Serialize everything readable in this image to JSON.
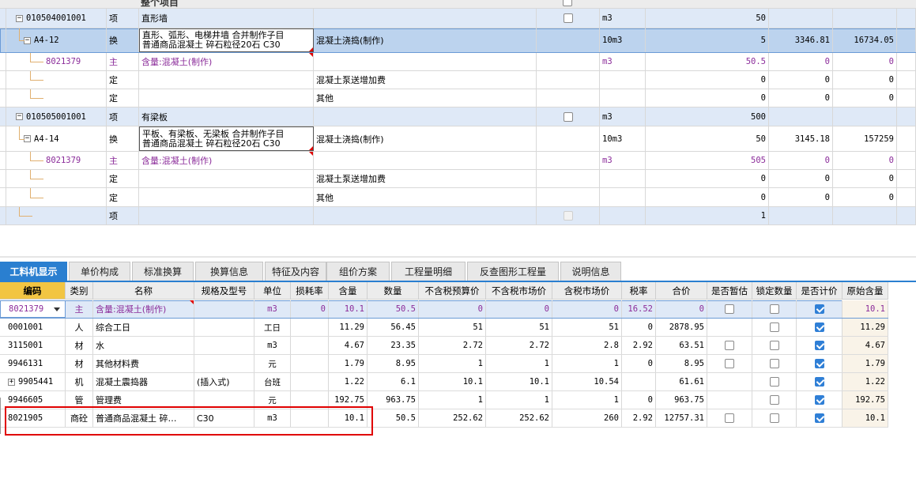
{
  "top_header": {
    "title": "整个项目"
  },
  "top_rows": [
    {
      "code": "010504001001",
      "type": "项",
      "name": "直形墙",
      "unit": "m3",
      "qty": "50"
    },
    {
      "code": "A4-12",
      "type": "换",
      "name_line1": "直形、弧形、电梯井墙  合并制作子目",
      "name_line2": "普通商品混凝土 碎石粒径20石 C30",
      "spec": "混凝土浇捣(制作)",
      "unit": "10m3",
      "qty": "5",
      "price": "3346.81",
      "total": "16734.05"
    },
    {
      "code": "8021379",
      "type": "主",
      "name": "含量:混凝土(制作)",
      "unit": "m3",
      "qty": "50.5",
      "price": "0",
      "total": "0"
    },
    {
      "type": "定",
      "spec": "混凝土泵送增加费",
      "qty": "0",
      "price": "0",
      "total": "0"
    },
    {
      "type": "定",
      "spec": "其他",
      "qty": "0",
      "price": "0",
      "total": "0"
    },
    {
      "code": "010505001001",
      "type": "项",
      "name": "有梁板",
      "unit": "m3",
      "qty": "500"
    },
    {
      "code": "A4-14",
      "type": "换",
      "name_line1": "平板、有梁板、无梁板  合并制作子目",
      "name_line2": "普通商品混凝土 碎石粒径20石 C30",
      "spec": "混凝土浇捣(制作)",
      "unit": "10m3",
      "qty": "50",
      "price": "3145.18",
      "total": "157259"
    },
    {
      "code": "8021379",
      "type": "主",
      "name": "含量:混凝土(制作)",
      "unit": "m3",
      "qty": "505",
      "price": "0",
      "total": "0"
    },
    {
      "type": "定",
      "spec": "混凝土泵送增加费",
      "qty": "0",
      "price": "0",
      "total": "0"
    },
    {
      "type": "定",
      "spec": "其他",
      "qty": "0",
      "price": "0",
      "total": "0"
    },
    {
      "type": "项",
      "qty": "1"
    }
  ],
  "tabs": [
    "工料机显示",
    "单价构成",
    "标准换算",
    "换算信息",
    "特征及内容",
    "组价方案",
    "工程量明细",
    "反查图形工程量",
    "说明信息"
  ],
  "columns": [
    "编码",
    "类别",
    "名称",
    "规格及型号",
    "单位",
    "损耗率",
    "含量",
    "数量",
    "不含税预算价",
    "不含税市场价",
    "含税市场价",
    "税率",
    "合价",
    "是否暂估",
    "锁定数量",
    "是否计价",
    "原始含量"
  ],
  "rows": [
    {
      "code": "8021379",
      "cat": "主",
      "name": "含量:混凝土(制作)",
      "spec": "",
      "unit": "m3",
      "loss": "0",
      "content": "10.1",
      "qty": "50.5",
      "p1": "0",
      "p2": "0",
      "p3": "0",
      "tax": "16.52",
      "total": "0",
      "est": false,
      "lock": false,
      "price_on": true,
      "orig": "10.1"
    },
    {
      "code": "0001001",
      "cat": "人",
      "name": "综合工日",
      "spec": "",
      "unit": "工日",
      "loss": "",
      "content": "11.29",
      "qty": "56.45",
      "p1": "51",
      "p2": "51",
      "p3": "51",
      "tax": "0",
      "total": "2878.95",
      "est": null,
      "lock": false,
      "price_on": true,
      "orig": "11.29"
    },
    {
      "code": "3115001",
      "cat": "材",
      "name": "水",
      "spec": "",
      "unit": "m3",
      "loss": "",
      "content": "4.67",
      "qty": "23.35",
      "p1": "2.72",
      "p2": "2.72",
      "p3": "2.8",
      "tax": "2.92",
      "total": "63.51",
      "est": false,
      "lock": false,
      "price_on": true,
      "orig": "4.67"
    },
    {
      "code": "9946131",
      "cat": "材",
      "name": "其他材料费",
      "spec": "",
      "unit": "元",
      "loss": "",
      "content": "1.79",
      "qty": "8.95",
      "p1": "1",
      "p2": "1",
      "p3": "1",
      "tax": "0",
      "total": "8.95",
      "est": false,
      "lock": false,
      "price_on": true,
      "orig": "1.79"
    },
    {
      "code": "9905441",
      "cat": "机",
      "name": "混凝土震捣器",
      "spec": "(插入式)",
      "unit": "台班",
      "loss": "",
      "content": "1.22",
      "qty": "6.1",
      "p1": "10.1",
      "p2": "10.1",
      "p3": "10.54",
      "tax": "",
      "total": "61.61",
      "est": null,
      "lock": false,
      "price_on": true,
      "orig": "1.22"
    },
    {
      "code": "9946605",
      "cat": "管",
      "name": "管理费",
      "spec": "",
      "unit": "元",
      "loss": "",
      "content": "192.75",
      "qty": "963.75",
      "p1": "1",
      "p2": "1",
      "p3": "1",
      "tax": "0",
      "total": "963.75",
      "est": null,
      "lock": false,
      "price_on": true,
      "orig": "192.75"
    },
    {
      "code": "8021905",
      "cat": "商砼",
      "name": "普通商品混凝土 碎…",
      "spec": "C30",
      "unit": "m3",
      "loss": "",
      "content": "10.1",
      "qty": "50.5",
      "p1": "252.62",
      "p2": "252.62",
      "p3": "260",
      "tax": "2.92",
      "total": "12757.31",
      "est": false,
      "lock": false,
      "price_on": true,
      "orig": "10.1"
    }
  ],
  "colors": {
    "tab_active": "#2a7fd0",
    "header_first": "#f2c542",
    "highlight_box": "#e00000",
    "purple_text": "#8b2c9a"
  }
}
